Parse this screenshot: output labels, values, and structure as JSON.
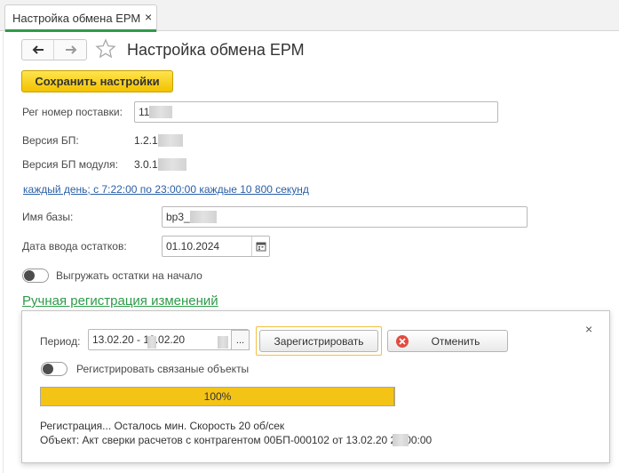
{
  "tab": {
    "title": "Настройка обмена ЕРМ",
    "close": "×"
  },
  "page": {
    "title": "Настройка обмена ЕРМ"
  },
  "toolbar": {
    "save_label": "Сохранить настройки"
  },
  "form": {
    "reg_number": {
      "label": "Рег номер поставки:",
      "value": "11"
    },
    "bp_version": {
      "label": "Версия БП:",
      "value": "1.2.1"
    },
    "module_version": {
      "label": "Версия БП модуля:",
      "value": "3.0.1"
    },
    "schedule_link": "каждый день; с 7:22:00 по 23:00:00 каждые 10 800 секунд",
    "db_name": {
      "label": "Имя базы:",
      "value": "bp3_"
    },
    "balance_date": {
      "label": "Дата ввода остатков:",
      "value": "01.10.2024"
    },
    "export_balances": {
      "label": "Выгружать остатки на начало",
      "on": false
    }
  },
  "manual": {
    "section_title": "Ручная регистрация изменений",
    "close": "×",
    "period": {
      "label": "Период:",
      "value": "13.02.20   - 13.02.20",
      "select": "..."
    },
    "register_label": "Зарегистрировать",
    "cancel_label": "Отменить",
    "related": {
      "label": "Регистрировать связаные объекты",
      "on": false
    },
    "progress": {
      "percent": 100,
      "text": "100%"
    },
    "status_line": "Регистрация... Осталось  мин. Скорость 20 об/сек",
    "object_line": "Объект: Акт сверки расчетов с контрагентом 00БП-000102 от 13.02.20     20:00:00"
  },
  "icons": {
    "back": "arrow-left-icon",
    "forward": "arrow-right-icon",
    "favorite": "star-icon",
    "calendar": "calendar-icon",
    "cancel": "cancel-x-circle-icon"
  },
  "colors": {
    "accent_yellow": "#f2c200",
    "link_blue": "#2b5fa5",
    "section_green": "#2e9a4a",
    "progress_fill": "#f3c316",
    "cancel_red": "#e24a3f"
  }
}
